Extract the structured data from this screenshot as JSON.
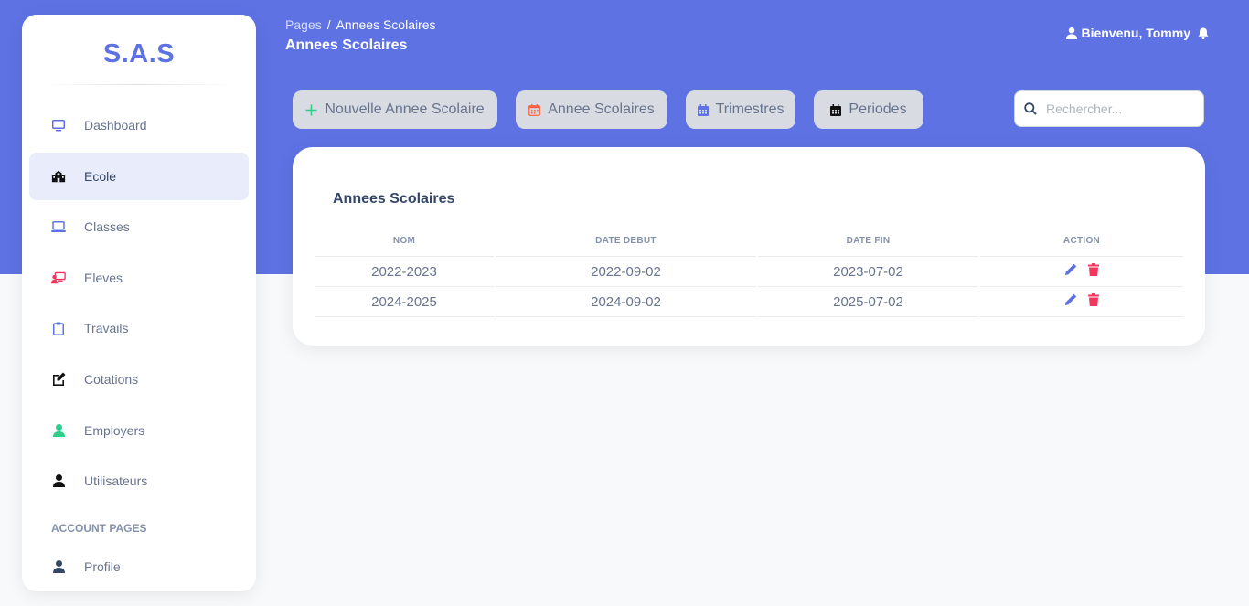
{
  "brand": "S.A.S",
  "sidebar": {
    "items": [
      {
        "label": "Dashboard",
        "icon": "monitor-icon",
        "color": "#5e72e4"
      },
      {
        "label": "Ecole",
        "icon": "school-icon",
        "color": "#000000"
      },
      {
        "label": "Classes",
        "icon": "laptop-icon",
        "color": "#5e72e4"
      },
      {
        "label": "Eleves",
        "icon": "teacher-icon",
        "color": "#f5365c"
      },
      {
        "label": "Travails",
        "icon": "clipboard-icon",
        "color": "#5e72e4"
      },
      {
        "label": "Cotations",
        "icon": "edit-icon",
        "color": "#000000"
      },
      {
        "label": "Employers",
        "icon": "user-icon",
        "color": "#2dce89"
      },
      {
        "label": "Utilisateurs",
        "icon": "user-icon",
        "color": "#000000"
      }
    ],
    "section_title": "ACCOUNT PAGES",
    "profile_label": "Profile"
  },
  "header": {
    "breadcrumb_root": "Pages",
    "breadcrumb_sep": "/",
    "breadcrumb_current": "Annees Scolaires",
    "title": "Annees Scolaires",
    "greeting": "Bienvenu, Tommy"
  },
  "toolbar": {
    "new_label": "Nouvelle Annee Scolaire",
    "years_label": "Annee Scolaires",
    "terms_label": "Trimestres",
    "periods_label": "Periodes"
  },
  "search": {
    "placeholder": "Rechercher..."
  },
  "table": {
    "title": "Annees Scolaires",
    "headers": [
      "NOM",
      "DATE DEBUT",
      "DATE FIN",
      "ACTION"
    ],
    "rows": [
      {
        "nom": "2022-2023",
        "debut": "2022-09-02",
        "fin": "2023-07-02"
      },
      {
        "nom": "2024-2025",
        "debut": "2024-09-02",
        "fin": "2025-07-02"
      }
    ]
  },
  "colors": {
    "accent": "#5e72e4",
    "danger": "#f5365c",
    "success": "#2dce89"
  }
}
